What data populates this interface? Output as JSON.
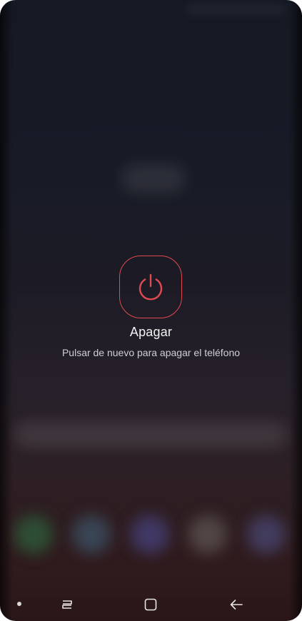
{
  "power_prompt": {
    "title": "Apagar",
    "subtitle": "Pulsar de nuevo para apagar el teléfono",
    "icon": "power-icon",
    "accent_color": "#e04a50"
  },
  "navigation_bar": {
    "buttons": [
      "recents-icon",
      "home-icon",
      "back-icon"
    ]
  }
}
